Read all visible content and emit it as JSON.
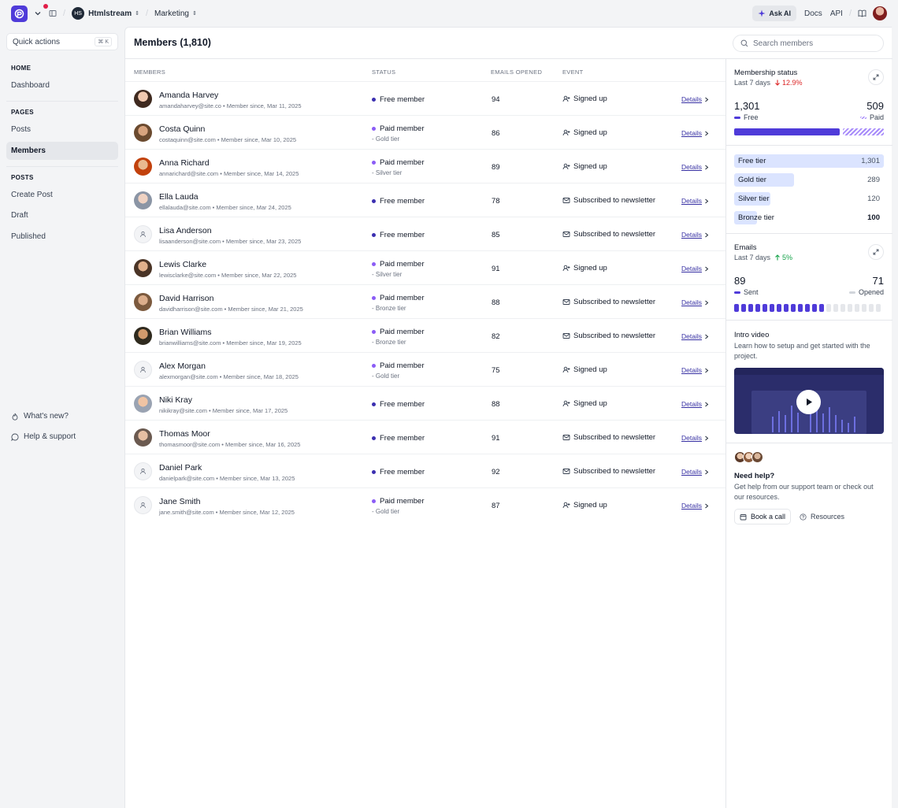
{
  "topbar": {
    "workspace_initials": "HS",
    "workspace_name": "Htmlstream",
    "section": "Marketing",
    "ask_ai": "Ask AI",
    "docs": "Docs",
    "api": "API"
  },
  "sidebar": {
    "quick_actions": "Quick actions",
    "shortcut": "⌘ K",
    "home_heading": "HOME",
    "dashboard": "Dashboard",
    "pages_heading": "PAGES",
    "posts": "Posts",
    "members": "Members",
    "posts_heading": "POSTS",
    "create_post": "Create Post",
    "draft": "Draft",
    "published": "Published",
    "whats_new": "What's new?",
    "help_support": "Help & support"
  },
  "main": {
    "title": "Members (1,810)",
    "search_placeholder": "Search members",
    "columns": [
      "MEMBERS",
      "STATUS",
      "EMAILS OPENED",
      "EVENT"
    ],
    "details_label": "Details",
    "members": [
      {
        "name": "Amanda Harvey",
        "sub": "amandaharvey@site.co • Member since, Mar 11, 2025",
        "status": "Free member",
        "tier": "",
        "opened": "94",
        "event": "Signed up",
        "event_icon": "user-plus-icon",
        "avatar": "photo"
      },
      {
        "name": "Costa Quinn",
        "sub": "costaquinn@site.com • Member since, Mar 10, 2025",
        "status": "Paid member",
        "tier": "- Gold tier",
        "opened": "86",
        "event": "Signed up",
        "event_icon": "user-plus-icon",
        "avatar": "photo"
      },
      {
        "name": "Anna Richard",
        "sub": "annarichard@site.com • Member since, Mar 14, 2025",
        "status": "Paid member",
        "tier": "- Silver tier",
        "opened": "89",
        "event": "Signed up",
        "event_icon": "user-plus-icon",
        "avatar": "photo"
      },
      {
        "name": "Ella Lauda",
        "sub": "ellalauda@site.com • Member since, Mar 24, 2025",
        "status": "Free member",
        "tier": "",
        "opened": "78",
        "event": "Subscribed to newsletter",
        "event_icon": "mail-icon",
        "avatar": "photo"
      },
      {
        "name": "Lisa Anderson",
        "sub": "lisaanderson@site.com • Member since, Mar 23, 2025",
        "status": "Free member",
        "tier": "",
        "opened": "85",
        "event": "Subscribed to newsletter",
        "event_icon": "mail-icon",
        "avatar": "placeholder"
      },
      {
        "name": "Lewis Clarke",
        "sub": "lewisclarke@site.com • Member since, Mar 22, 2025",
        "status": "Paid member",
        "tier": "- Silver tier",
        "opened": "91",
        "event": "Signed up",
        "event_icon": "user-plus-icon",
        "avatar": "photo"
      },
      {
        "name": "David Harrison",
        "sub": "davidharrison@site.com • Member since, Mar 21, 2025",
        "status": "Paid member",
        "tier": "- Bronze tier",
        "opened": "88",
        "event": "Subscribed to newsletter",
        "event_icon": "mail-icon",
        "avatar": "photo"
      },
      {
        "name": "Brian Williams",
        "sub": "brianwilliams@site.com • Member since, Mar 19, 2025",
        "status": "Paid member",
        "tier": "- Bronze tier",
        "opened": "82",
        "event": "Subscribed to newsletter",
        "event_icon": "mail-icon",
        "avatar": "photo"
      },
      {
        "name": "Alex Morgan",
        "sub": "alexmorgan@site.com • Member since, Mar 18, 2025",
        "status": "Paid member",
        "tier": "- Gold tier",
        "opened": "75",
        "event": "Signed up",
        "event_icon": "user-plus-icon",
        "avatar": "placeholder"
      },
      {
        "name": "Niki Kray",
        "sub": "nikikray@site.com • Member since, Mar 17, 2025",
        "status": "Free member",
        "tier": "",
        "opened": "88",
        "event": "Signed up",
        "event_icon": "user-plus-icon",
        "avatar": "photo"
      },
      {
        "name": "Thomas Moor",
        "sub": "thomasmoor@site.com • Member since, Mar 16, 2025",
        "status": "Free member",
        "tier": "",
        "opened": "91",
        "event": "Subscribed to newsletter",
        "event_icon": "mail-icon",
        "avatar": "photo"
      },
      {
        "name": "Daniel Park",
        "sub": "danielpark@site.com • Member since, Mar 13, 2025",
        "status": "Free member",
        "tier": "",
        "opened": "92",
        "event": "Subscribed to newsletter",
        "event_icon": "mail-icon",
        "avatar": "placeholder"
      },
      {
        "name": "Jane Smith",
        "sub": "jane.smith@site.com • Member since, Mar 12, 2025",
        "status": "Paid member",
        "tier": "- Gold tier",
        "opened": "87",
        "event": "Signed up",
        "event_icon": "user-plus-icon",
        "avatar": "placeholder"
      }
    ]
  },
  "panel": {
    "membership": {
      "title": "Membership status",
      "period": "Last 7 days",
      "change": "12.9%",
      "free_value": "1,301",
      "free_label": "Free",
      "paid_value": "509",
      "paid_label": "Paid",
      "free_fraction": 0.72
    },
    "tiers": [
      {
        "label": "Free tier",
        "value": "1,301",
        "fraction": 1.0
      },
      {
        "label": "Gold tier",
        "value": "289",
        "fraction": 0.4
      },
      {
        "label": "Silver tier",
        "value": "120",
        "fraction": 0.24
      },
      {
        "label": "Bronze tier",
        "value": "100",
        "fraction": 0.15
      }
    ],
    "emails": {
      "title": "Emails",
      "period": "Last 7 days",
      "change": "5%",
      "sent_value": "89",
      "sent_label": "Sent",
      "opened_value": "71",
      "opened_label": "Opened",
      "filled_ratio": 0.61
    },
    "video": {
      "title": "Intro video",
      "description": "Learn how to setup and get started with the project."
    },
    "help": {
      "title": "Need help?",
      "description": "Get help from our support team or check out our resources.",
      "book_call": "Book a call",
      "resources": "Resources"
    },
    "colors": {
      "accent": "#4f3bd9",
      "paid_dot": "#8b5cf6",
      "free_dot": "#3b2fb0",
      "negative": "#dc2626",
      "positive": "#16a34a"
    }
  }
}
